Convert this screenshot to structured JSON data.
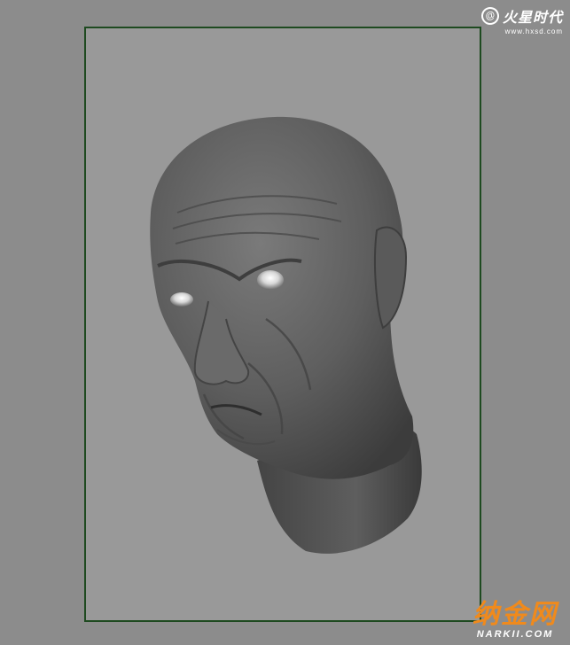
{
  "viewport": {
    "background": "#8c8c8c",
    "gate_color": "#1e4a20"
  },
  "watermark_top": {
    "icon": "swirl-logo-icon",
    "name": "火星时代",
    "url": "www.hxsd.com"
  },
  "watermark_bottom": {
    "name": "纳金网",
    "url": "NARKII.COM",
    "color": "#f08a1c"
  }
}
